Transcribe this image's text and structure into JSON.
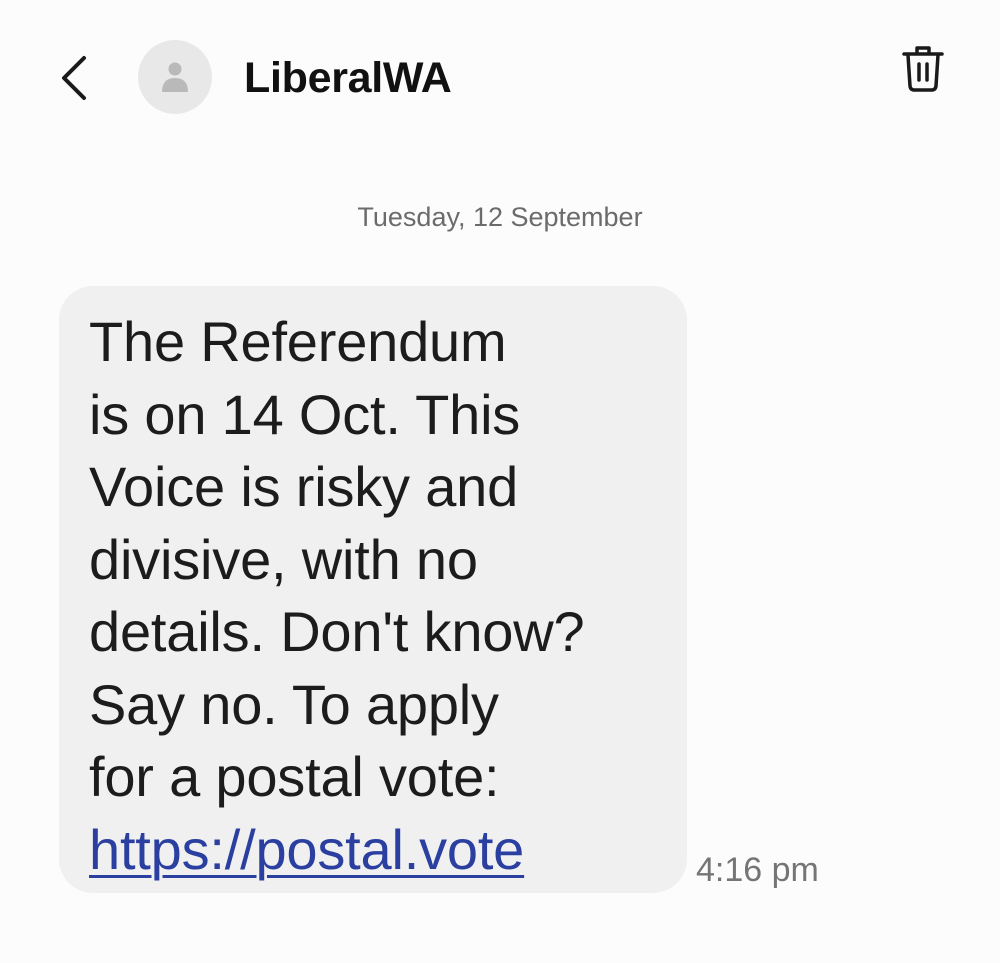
{
  "header": {
    "contact_name": "LiberalWA",
    "back_icon": "chevron-left-icon",
    "avatar_icon": "person-icon",
    "delete_icon": "trash-icon"
  },
  "conversation": {
    "date_separator": "Tuesday, 12 September",
    "message": {
      "lines": [
        "The Referendum",
        "is on 14 Oct. This",
        "Voice is risky and",
        "divisive, with no",
        "details. Don't know?",
        "Say no. To apply",
        "for a postal vote:"
      ],
      "link": "https://postal.vote",
      "time": "4:16 pm"
    }
  },
  "colors": {
    "background": "#fcfcfc",
    "bubble": "#f0f0f0",
    "link": "#2a3fa0",
    "secondary_text": "#6b6b6b"
  }
}
